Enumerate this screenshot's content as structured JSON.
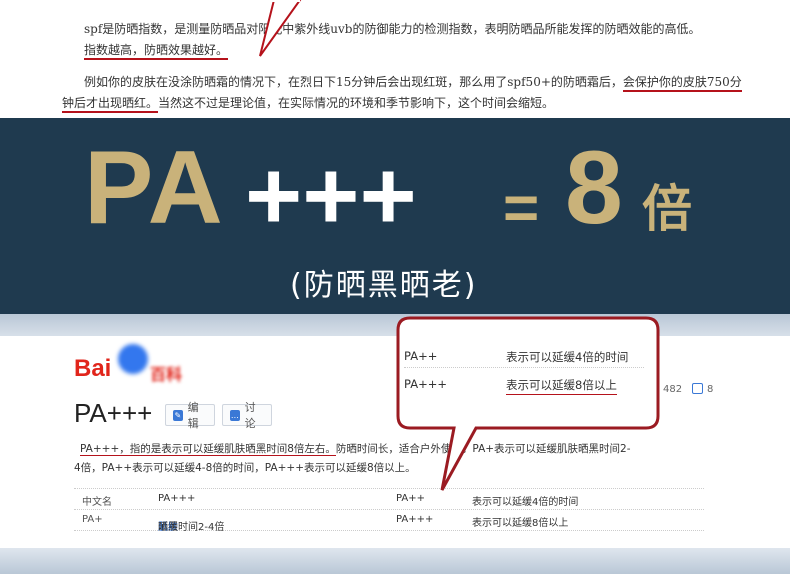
{
  "article": {
    "line1": "spf是防晒指数，是测量防晒品对阳光中紫外线uvb的防御能力的检测指数，表明防晒品所能发挥的防晒效能的高低。",
    "line1b": "指数越高，防晒效果越好。",
    "line2a": "例如你的皮肤在没涂防晒霜的情况下，在烈日下15分钟后会出现红斑，那么用了spf50+的防晒霜后，",
    "line2b": "会保护你的皮肤750分",
    "line3a": "钟后才出现晒红。",
    "line3b": "当然这不过是理论值，在实际情况的环境和季节影响下，这个时间会缩短。"
  },
  "banner": {
    "pa": "PA",
    "plus": "+++",
    "equals": "=",
    "number": "8",
    "unit": "倍",
    "subtitle": "(防晒黑晒老)"
  },
  "baike": {
    "logo_text": "Bai",
    "title": "PA+++",
    "edit_label": "编辑",
    "discuss_label": "讨论",
    "count": "482",
    "share_count": "8",
    "desc_underlined": "PA+++，指的是表示可以延缓肌肤晒黑时间8倍左右。",
    "desc_rest": "防晒时间长，适合户外使用。PA+表示可以延缓肌肤晒黑时间2-",
    "desc_line2": "4倍，PA++表示可以延缓4-8倍的时间，PA+++表示可以延缓8倍以上。",
    "table": [
      {
        "c1": "中文名",
        "c2": "PA+++",
        "c3": "PA++",
        "c4": "表示可以延缓4倍的时间"
      },
      {
        "c1": "PA+",
        "c2a": "延缓",
        "c2b": "肌肤",
        "c2c": "晒黑时间2-4倍",
        "c3": "PA+++",
        "c4": "表示可以延缓8倍以上"
      }
    ]
  },
  "callout": {
    "rows": [
      {
        "key": "PA++",
        "value": "表示可以延缓4倍的时间"
      },
      {
        "key": "PA+++",
        "value": "表示可以延缓8倍以上"
      }
    ]
  },
  "colors": {
    "banner_bg": "#1f3a4f",
    "gold": "#c9b27a",
    "red_accent": "#b5121b",
    "link_blue": "#2a6fd6"
  }
}
